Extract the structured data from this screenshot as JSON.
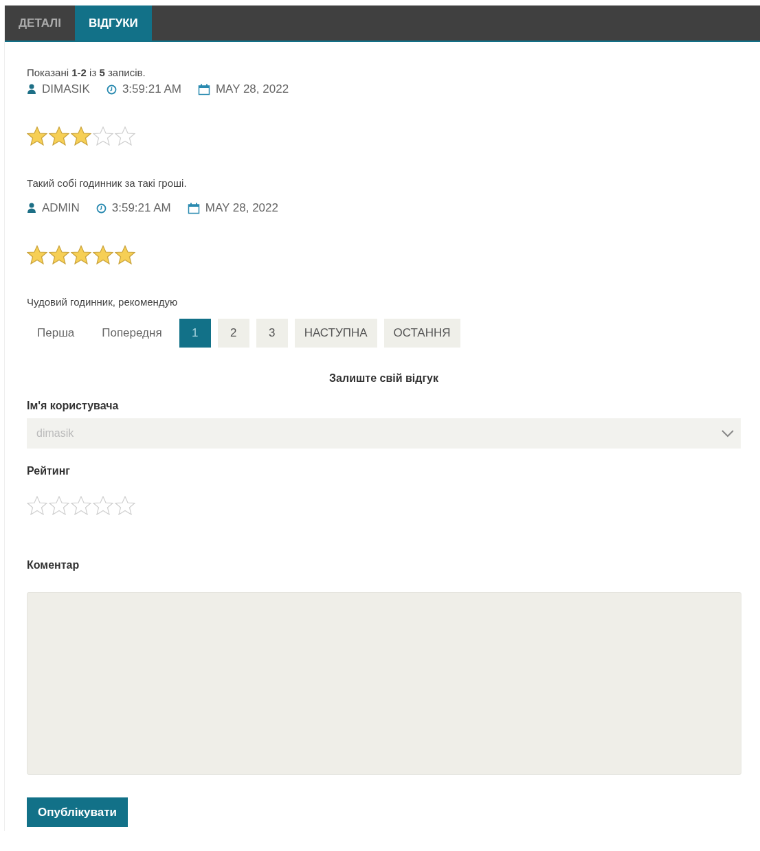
{
  "tabs": [
    {
      "label": "ДЕТАЛІ",
      "selected": false
    },
    {
      "label": "ВІДГУКИ",
      "selected": true
    }
  ],
  "summary": "Показані **1-2** із **5** записів.",
  "reviews": [
    {
      "author": "DIMASIK",
      "time": "3:59:21 AM",
      "date": "MAY 28, 2022",
      "stars": 3,
      "comment": "Такий собі годинник за такі гроші."
    },
    {
      "author": "ADMIN",
      "time": "3:59:21 AM",
      "date": "MAY 28, 2022",
      "stars": 5,
      "comment": "Чудовий годинник, рекомендую"
    }
  ],
  "pagination": [
    {
      "label": "Перша",
      "kind": "link",
      "selected": false
    },
    {
      "label": "Попередня",
      "kind": "link",
      "selected": false
    },
    {
      "label": "1",
      "kind": "page",
      "selected": true
    },
    {
      "label": "2",
      "kind": "page",
      "selected": false
    },
    {
      "label": "3",
      "kind": "page",
      "selected": false
    },
    {
      "label": "НАСТУПНА",
      "kind": "page",
      "selected": false
    },
    {
      "label": "ОСТАННЯ",
      "kind": "page",
      "selected": false
    }
  ],
  "form": {
    "heading": "Залиште свій відгук",
    "username_label": "Ім'я користувача",
    "username_value": "dimasik",
    "username_disabled": true,
    "rating_label": "Рейтинг",
    "rating": {
      "stars": 0
    },
    "comment_label": "Коментар",
    "submit": "Опублікувати"
  }
}
